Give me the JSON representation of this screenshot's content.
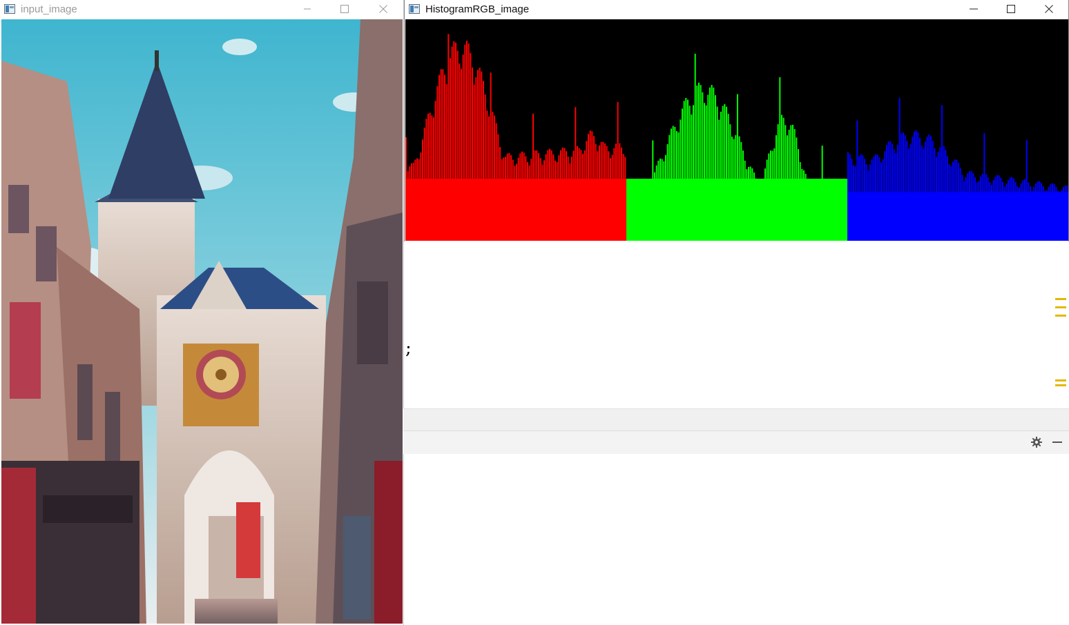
{
  "window_left": {
    "title": "input_image",
    "icon": "app-window-icon",
    "controls": [
      "minimize-icon",
      "maximize-icon",
      "close-icon"
    ]
  },
  "window_right": {
    "title": "HistogramRGB_image",
    "icon": "app-window-icon",
    "controls": [
      "minimize-icon",
      "maximize-icon",
      "close-icon"
    ]
  },
  "histogram": {
    "background": "#000000",
    "channels": [
      {
        "color": "#ff0000"
      },
      {
        "color": "#00ff00"
      },
      {
        "color": "#0000ff"
      }
    ]
  },
  "editor": {
    "stray_text": ";",
    "toolbar_icons": [
      "gear-icon",
      "minus-icon"
    ],
    "marker_color": "#e3b800"
  }
}
